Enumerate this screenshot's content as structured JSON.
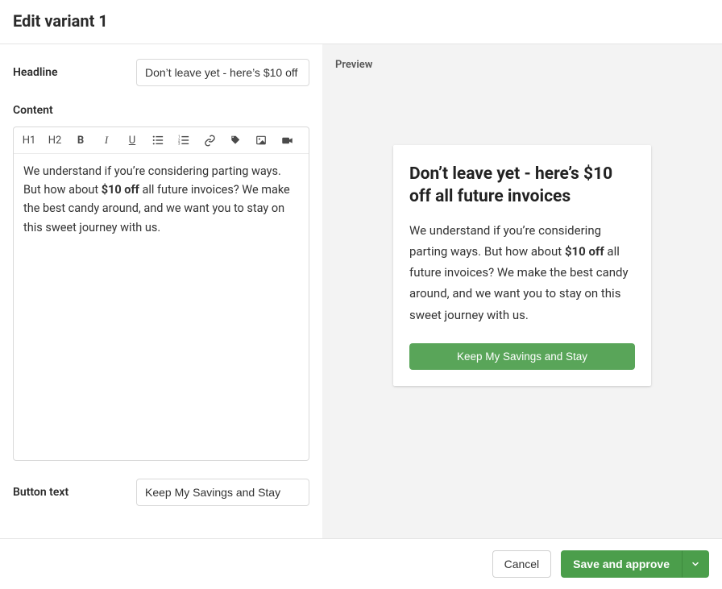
{
  "header": {
    "title": "Edit variant 1"
  },
  "form": {
    "headline_label": "Headline",
    "headline_value": "Don’t leave yet - here’s $10 off",
    "content_label": "Content",
    "toolbar": {
      "h1": "H1",
      "h2": "H2",
      "b": "B",
      "i": "I",
      "u": "U"
    },
    "content_pre": "We understand if you’re considering parting ways. But how about ",
    "content_bold": "$10 off",
    "content_post": " all future invoices? We make the best candy around, and we want you to stay on this sweet journey with us.",
    "button_text_label": "Button text",
    "button_text_value": "Keep My Savings and Stay"
  },
  "preview": {
    "label": "Preview",
    "title": "Don’t leave yet - here’s $10 off all future invoices",
    "body_pre": "We understand if you’re considering parting ways. But how about ",
    "body_bold": "$10 off",
    "body_post": " all future invoices? We make the best candy around, and we want you to stay on this sweet journey with us.",
    "cta": "Keep My Savings and Stay"
  },
  "footer": {
    "cancel": "Cancel",
    "save": "Save and approve"
  }
}
